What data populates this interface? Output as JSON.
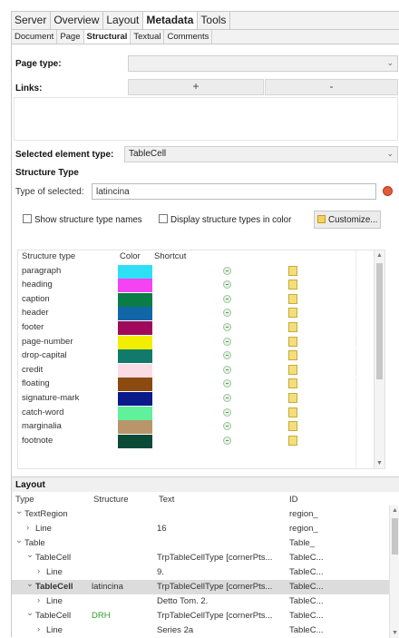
{
  "top_tabs": [
    "Server",
    "Overview",
    "Layout",
    "Metadata",
    "Tools"
  ],
  "sub_tabs": [
    "Document",
    "Page",
    "Structural",
    "Textual",
    "Comments"
  ],
  "page_type": {
    "label": "Page type:",
    "value": ""
  },
  "links": {
    "label": "Links:",
    "add_label": "+",
    "remove_label": "-"
  },
  "selected_element": {
    "label": "Selected element type:",
    "value": "TableCell"
  },
  "structure_type": {
    "title": "Structure Type",
    "type_label": "Type of selected:",
    "type_value": "latincina",
    "show_names_label": "Show structure type names",
    "display_colors_label": "Display structure types in color",
    "customize_label": "Customize..."
  },
  "structure_table": {
    "headers": [
      "Structure type",
      "Color",
      "Shortcut"
    ],
    "rows": [
      {
        "name": "paragraph",
        "color": "#2ee0f5"
      },
      {
        "name": "heading",
        "color": "#f542f2"
      },
      {
        "name": "caption",
        "color": "#0a7d46"
      },
      {
        "name": "header",
        "color": "#1166a8"
      },
      {
        "name": "footer",
        "color": "#a00a5a"
      },
      {
        "name": "page-number",
        "color": "#f2ee00"
      },
      {
        "name": "drop-capital",
        "color": "#127a6a"
      },
      {
        "name": "credit",
        "color": "#fadce6"
      },
      {
        "name": "floating",
        "color": "#8a4a10"
      },
      {
        "name": "signature-mark",
        "color": "#0a1a8a"
      },
      {
        "name": "catch-word",
        "color": "#5ff29a"
      },
      {
        "name": "marginalia",
        "color": "#b8956a"
      },
      {
        "name": "footnote",
        "color": "#0a4a36"
      }
    ]
  },
  "layout": {
    "title": "Layout",
    "headers": [
      "Type",
      "Structure",
      "Text",
      "ID"
    ],
    "rows": [
      {
        "indent": 0,
        "toggle": "v",
        "type": "TextRegion",
        "structure": "",
        "text": "",
        "id": "region_"
      },
      {
        "indent": 1,
        "toggle": ">",
        "type": "Line",
        "structure": "",
        "text": "16",
        "id": "region_"
      },
      {
        "indent": 0,
        "toggle": "v",
        "type": "Table",
        "structure": "",
        "text": "",
        "id": "Table_"
      },
      {
        "indent": 1,
        "toggle": "v",
        "type": "TableCell",
        "structure": "",
        "text": "TrpTableCellType [cornerPts...",
        "id": "TableC..."
      },
      {
        "indent": 2,
        "toggle": ">",
        "type": "Line",
        "structure": "",
        "text": "9.",
        "id": "TableC..."
      },
      {
        "indent": 1,
        "toggle": "v",
        "type": "TableCell",
        "structure": "latincina",
        "text": "TrpTableCellType [cornerPts...",
        "id": "TableC...",
        "selected": true
      },
      {
        "indent": 2,
        "toggle": ">",
        "type": "Line",
        "structure": "",
        "text": "Detto Tom. 2.",
        "id": "TableC..."
      },
      {
        "indent": 1,
        "toggle": "v",
        "type": "TableCell",
        "structure": "DRH",
        "structure_green": true,
        "text": "TrpTableCellType [cornerPts...",
        "id": "TableC..."
      },
      {
        "indent": 2,
        "toggle": ">",
        "type": "Line",
        "structure": "",
        "text": "Series 2a",
        "id": "TableC..."
      }
    ]
  }
}
